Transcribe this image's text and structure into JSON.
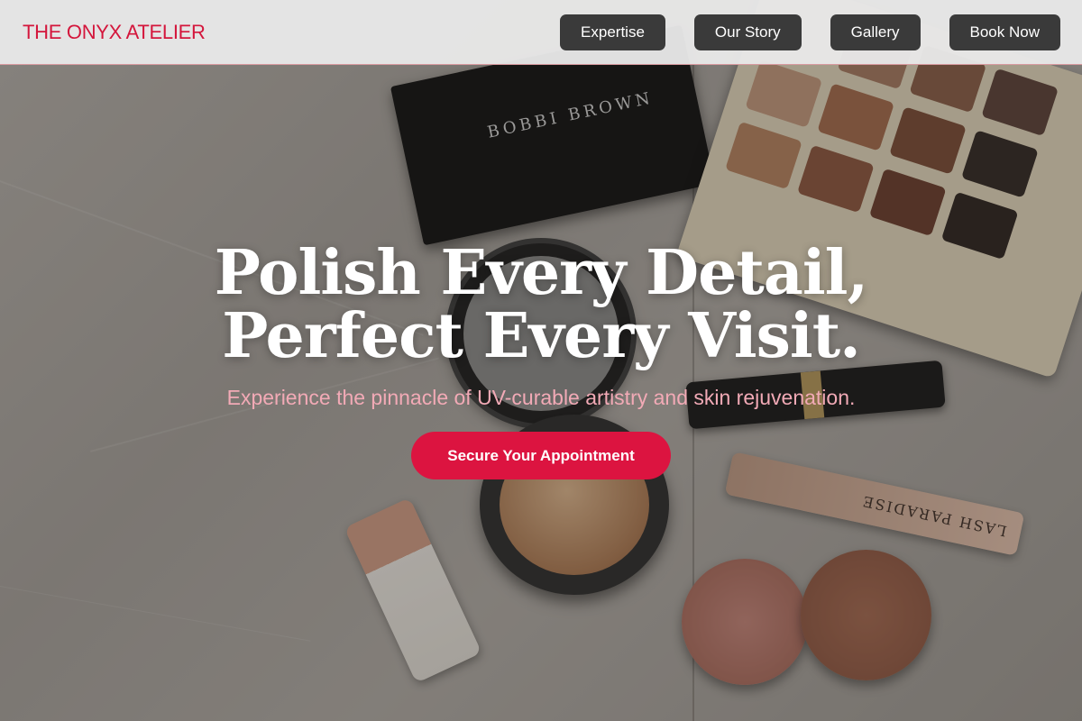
{
  "header": {
    "logo": "THE ONYX ATELIER",
    "nav": [
      {
        "label": "Expertise"
      },
      {
        "label": "Our Story"
      },
      {
        "label": "Gallery"
      },
      {
        "label": "Book Now"
      }
    ]
  },
  "hero": {
    "title_line1": "Polish Every Detail,",
    "title_line2": "Perfect Every Visit.",
    "subtitle": "Experience the pinnacle of UV-curable artistry and skin rejuvenation.",
    "cta_label": "Secure Your Appointment",
    "background_image": "flat-lay of makeup products on marble table",
    "product_label": "BOBBI BROWN",
    "product_label_2": "LASH PARADISE"
  },
  "colors": {
    "accent": "#dc1440",
    "logo": "#d4163c",
    "subtitle": "#f2aab6",
    "nav_button": "#3a3a3a",
    "header_bg": "#e8e8e8"
  }
}
